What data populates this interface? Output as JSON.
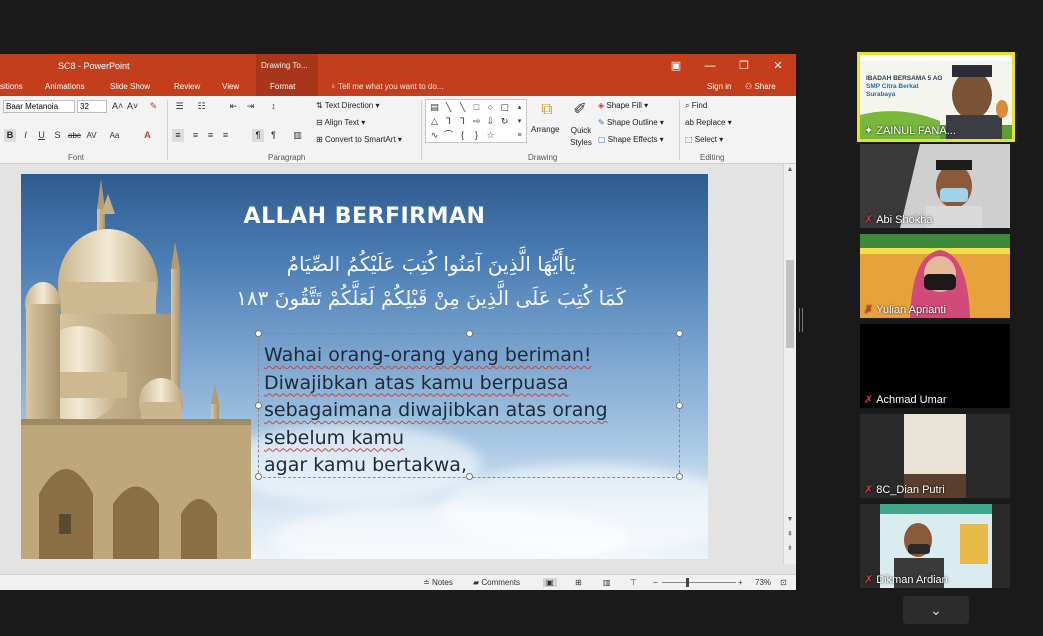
{
  "window": {
    "title": "SC8 - PowerPoint",
    "context_tab_group": "Drawing To...",
    "sign_in": "Sign in",
    "share": "Share",
    "tell_me": "Tell me what you want to do..."
  },
  "tabs": [
    "sitions",
    "Animations",
    "Slide Show",
    "Review",
    "View",
    "Format"
  ],
  "ribbon": {
    "font": {
      "label": "Font",
      "font_name": "Baar Metanoia",
      "font_size": "32",
      "grow": "A˄",
      "shrink": "A˅"
    },
    "paragraph": {
      "label": "Paragraph",
      "text_direction": "Text Direction",
      "align_text": "Align Text",
      "convert_smartart": "Convert to SmartArt"
    },
    "drawing": {
      "label": "Drawing",
      "arrange": "Arrange",
      "quick_styles": "Quick Styles",
      "shape_fill": "Shape Fill",
      "shape_outline": "Shape Outline",
      "shape_effects": "Shape Effects"
    },
    "editing": {
      "label": "Editing",
      "find": "Find",
      "replace": "Replace",
      "select": "Select"
    }
  },
  "slide": {
    "title": "ALLAH BERFIRMAN",
    "arabic_line1": "يَاأَيُّهَا الَّذِينَ آمَنُوا كُتِبَ عَلَيْكُمُ الصِّيَامُ",
    "arabic_line2": "كَمَا كُتِبَ عَلَى الَّذِينَ مِنْ قَبْلِكُمْ لَعَلَّكُمْ تَتَّقُونَ ١٨٣",
    "body_lines": [
      "Wahai orang-orang yang beriman!",
      "Diwajibkan atas kamu berpuasa",
      "sebagaimana diwajibkan atas orang",
      "sebelum kamu",
      "agar kamu bertakwa,"
    ]
  },
  "statusbar": {
    "notes": "Notes",
    "comments": "Comments",
    "zoom": "73%"
  },
  "participants": [
    {
      "name": "ZAINUL FANA...",
      "muted": false,
      "active": true
    },
    {
      "name": "Abi Shokha",
      "muted": true,
      "active": false
    },
    {
      "name": "Yulian Aprianti",
      "muted": true,
      "active": false
    },
    {
      "name": "Achmad Umar",
      "muted": true,
      "active": false
    },
    {
      "name": "8C_Dian Putri",
      "muted": true,
      "active": false
    },
    {
      "name": "Dikman Ardian",
      "muted": true,
      "active": false
    }
  ],
  "active_banner": {
    "line1": "IBADAH BERSAMA 5 AG",
    "line2": "SMP Citra Berkat",
    "line3": "Surabaya"
  }
}
